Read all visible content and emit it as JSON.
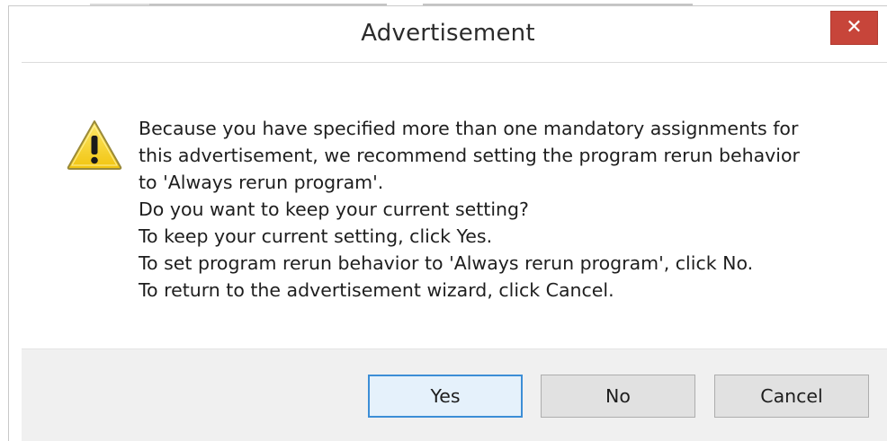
{
  "dialog": {
    "title": "Advertisement",
    "close_label": "✕",
    "icon": "warning-icon",
    "message_lines": [
      "Because you have specified more than one mandatory assignments for",
      "this advertisement, we recommend setting the program rerun behavior",
      "to 'Always rerun program'.",
      "Do you want to keep your current setting?",
      "To keep your current setting, click Yes.",
      "To set program rerun behavior to 'Always rerun program', click No.",
      "To return to the advertisement wizard, click Cancel."
    ],
    "buttons": {
      "yes_label": "Yes",
      "no_label": "No",
      "cancel_label": "Cancel"
    }
  },
  "colors": {
    "close_button": "#c7453a",
    "footer_background": "#f0f0f0",
    "default_button_border": "#3c8ed6",
    "warning_fill": "#f6d21b"
  }
}
